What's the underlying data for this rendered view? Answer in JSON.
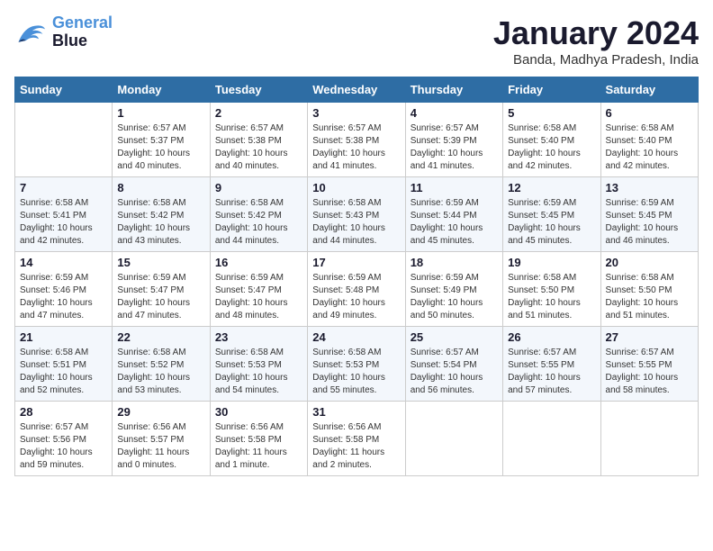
{
  "header": {
    "logo_line1": "General",
    "logo_line2": "Blue",
    "month_title": "January 2024",
    "subtitle": "Banda, Madhya Pradesh, India"
  },
  "days_of_week": [
    "Sunday",
    "Monday",
    "Tuesday",
    "Wednesday",
    "Thursday",
    "Friday",
    "Saturday"
  ],
  "weeks": [
    [
      {
        "day": "",
        "info": ""
      },
      {
        "day": "1",
        "info": "Sunrise: 6:57 AM\nSunset: 5:37 PM\nDaylight: 10 hours\nand 40 minutes."
      },
      {
        "day": "2",
        "info": "Sunrise: 6:57 AM\nSunset: 5:38 PM\nDaylight: 10 hours\nand 40 minutes."
      },
      {
        "day": "3",
        "info": "Sunrise: 6:57 AM\nSunset: 5:38 PM\nDaylight: 10 hours\nand 41 minutes."
      },
      {
        "day": "4",
        "info": "Sunrise: 6:57 AM\nSunset: 5:39 PM\nDaylight: 10 hours\nand 41 minutes."
      },
      {
        "day": "5",
        "info": "Sunrise: 6:58 AM\nSunset: 5:40 PM\nDaylight: 10 hours\nand 42 minutes."
      },
      {
        "day": "6",
        "info": "Sunrise: 6:58 AM\nSunset: 5:40 PM\nDaylight: 10 hours\nand 42 minutes."
      }
    ],
    [
      {
        "day": "7",
        "info": "Sunrise: 6:58 AM\nSunset: 5:41 PM\nDaylight: 10 hours\nand 42 minutes."
      },
      {
        "day": "8",
        "info": "Sunrise: 6:58 AM\nSunset: 5:42 PM\nDaylight: 10 hours\nand 43 minutes."
      },
      {
        "day": "9",
        "info": "Sunrise: 6:58 AM\nSunset: 5:42 PM\nDaylight: 10 hours\nand 44 minutes."
      },
      {
        "day": "10",
        "info": "Sunrise: 6:58 AM\nSunset: 5:43 PM\nDaylight: 10 hours\nand 44 minutes."
      },
      {
        "day": "11",
        "info": "Sunrise: 6:59 AM\nSunset: 5:44 PM\nDaylight: 10 hours\nand 45 minutes."
      },
      {
        "day": "12",
        "info": "Sunrise: 6:59 AM\nSunset: 5:45 PM\nDaylight: 10 hours\nand 45 minutes."
      },
      {
        "day": "13",
        "info": "Sunrise: 6:59 AM\nSunset: 5:45 PM\nDaylight: 10 hours\nand 46 minutes."
      }
    ],
    [
      {
        "day": "14",
        "info": "Sunrise: 6:59 AM\nSunset: 5:46 PM\nDaylight: 10 hours\nand 47 minutes."
      },
      {
        "day": "15",
        "info": "Sunrise: 6:59 AM\nSunset: 5:47 PM\nDaylight: 10 hours\nand 47 minutes."
      },
      {
        "day": "16",
        "info": "Sunrise: 6:59 AM\nSunset: 5:47 PM\nDaylight: 10 hours\nand 48 minutes."
      },
      {
        "day": "17",
        "info": "Sunrise: 6:59 AM\nSunset: 5:48 PM\nDaylight: 10 hours\nand 49 minutes."
      },
      {
        "day": "18",
        "info": "Sunrise: 6:59 AM\nSunset: 5:49 PM\nDaylight: 10 hours\nand 50 minutes."
      },
      {
        "day": "19",
        "info": "Sunrise: 6:58 AM\nSunset: 5:50 PM\nDaylight: 10 hours\nand 51 minutes."
      },
      {
        "day": "20",
        "info": "Sunrise: 6:58 AM\nSunset: 5:50 PM\nDaylight: 10 hours\nand 51 minutes."
      }
    ],
    [
      {
        "day": "21",
        "info": "Sunrise: 6:58 AM\nSunset: 5:51 PM\nDaylight: 10 hours\nand 52 minutes."
      },
      {
        "day": "22",
        "info": "Sunrise: 6:58 AM\nSunset: 5:52 PM\nDaylight: 10 hours\nand 53 minutes."
      },
      {
        "day": "23",
        "info": "Sunrise: 6:58 AM\nSunset: 5:53 PM\nDaylight: 10 hours\nand 54 minutes."
      },
      {
        "day": "24",
        "info": "Sunrise: 6:58 AM\nSunset: 5:53 PM\nDaylight: 10 hours\nand 55 minutes."
      },
      {
        "day": "25",
        "info": "Sunrise: 6:57 AM\nSunset: 5:54 PM\nDaylight: 10 hours\nand 56 minutes."
      },
      {
        "day": "26",
        "info": "Sunrise: 6:57 AM\nSunset: 5:55 PM\nDaylight: 10 hours\nand 57 minutes."
      },
      {
        "day": "27",
        "info": "Sunrise: 6:57 AM\nSunset: 5:55 PM\nDaylight: 10 hours\nand 58 minutes."
      }
    ],
    [
      {
        "day": "28",
        "info": "Sunrise: 6:57 AM\nSunset: 5:56 PM\nDaylight: 10 hours\nand 59 minutes."
      },
      {
        "day": "29",
        "info": "Sunrise: 6:56 AM\nSunset: 5:57 PM\nDaylight: 11 hours\nand 0 minutes."
      },
      {
        "day": "30",
        "info": "Sunrise: 6:56 AM\nSunset: 5:58 PM\nDaylight: 11 hours\nand 1 minute."
      },
      {
        "day": "31",
        "info": "Sunrise: 6:56 AM\nSunset: 5:58 PM\nDaylight: 11 hours\nand 2 minutes."
      },
      {
        "day": "",
        "info": ""
      },
      {
        "day": "",
        "info": ""
      },
      {
        "day": "",
        "info": ""
      }
    ]
  ]
}
